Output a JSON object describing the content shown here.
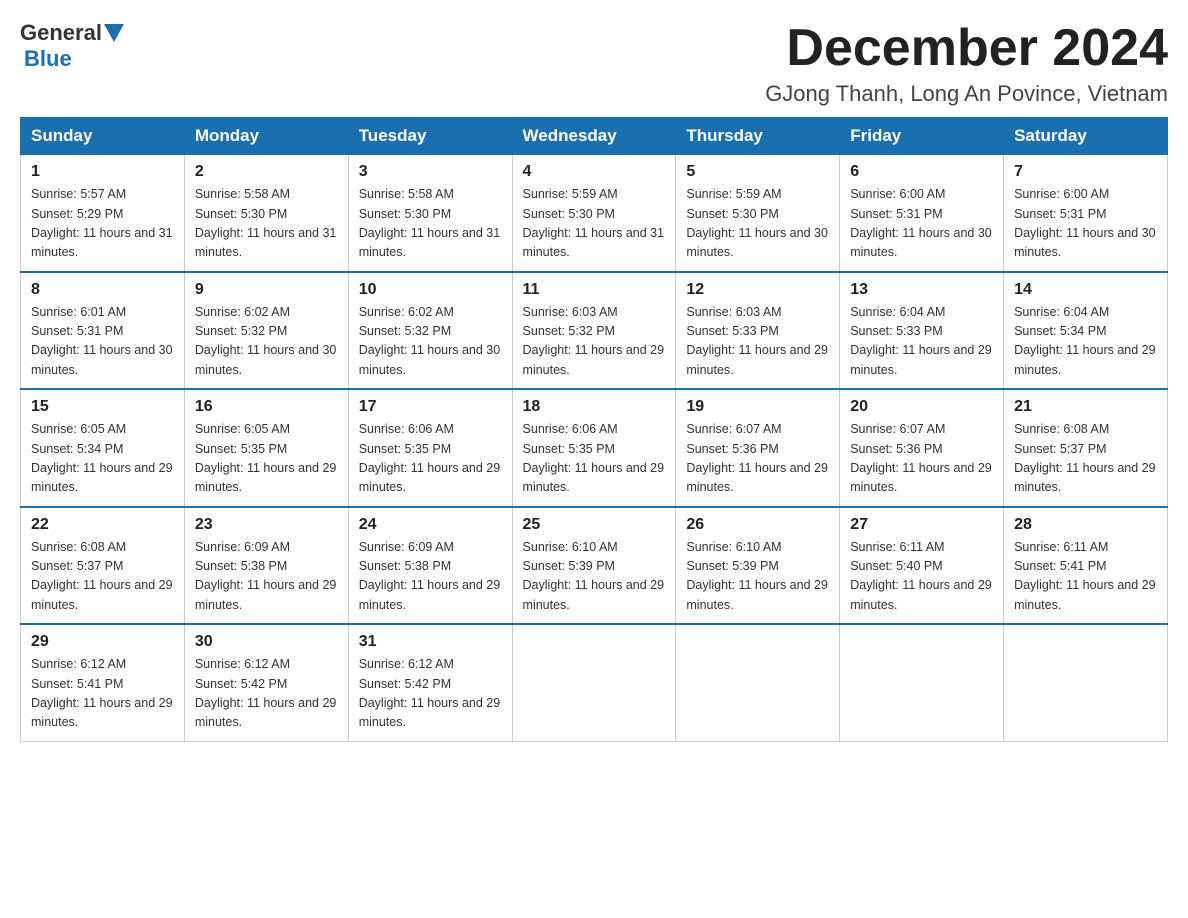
{
  "header": {
    "logo": {
      "general": "General",
      "blue": "Blue"
    },
    "title": "December 2024",
    "location": "GJong Thanh, Long An Povince, Vietnam"
  },
  "weekdays": [
    "Sunday",
    "Monday",
    "Tuesday",
    "Wednesday",
    "Thursday",
    "Friday",
    "Saturday"
  ],
  "weeks": [
    [
      {
        "day": "1",
        "sunrise": "5:57 AM",
        "sunset": "5:29 PM",
        "daylight": "11 hours and 31 minutes."
      },
      {
        "day": "2",
        "sunrise": "5:58 AM",
        "sunset": "5:30 PM",
        "daylight": "11 hours and 31 minutes."
      },
      {
        "day": "3",
        "sunrise": "5:58 AM",
        "sunset": "5:30 PM",
        "daylight": "11 hours and 31 minutes."
      },
      {
        "day": "4",
        "sunrise": "5:59 AM",
        "sunset": "5:30 PM",
        "daylight": "11 hours and 31 minutes."
      },
      {
        "day": "5",
        "sunrise": "5:59 AM",
        "sunset": "5:30 PM",
        "daylight": "11 hours and 30 minutes."
      },
      {
        "day": "6",
        "sunrise": "6:00 AM",
        "sunset": "5:31 PM",
        "daylight": "11 hours and 30 minutes."
      },
      {
        "day": "7",
        "sunrise": "6:00 AM",
        "sunset": "5:31 PM",
        "daylight": "11 hours and 30 minutes."
      }
    ],
    [
      {
        "day": "8",
        "sunrise": "6:01 AM",
        "sunset": "5:31 PM",
        "daylight": "11 hours and 30 minutes."
      },
      {
        "day": "9",
        "sunrise": "6:02 AM",
        "sunset": "5:32 PM",
        "daylight": "11 hours and 30 minutes."
      },
      {
        "day": "10",
        "sunrise": "6:02 AM",
        "sunset": "5:32 PM",
        "daylight": "11 hours and 30 minutes."
      },
      {
        "day": "11",
        "sunrise": "6:03 AM",
        "sunset": "5:32 PM",
        "daylight": "11 hours and 29 minutes."
      },
      {
        "day": "12",
        "sunrise": "6:03 AM",
        "sunset": "5:33 PM",
        "daylight": "11 hours and 29 minutes."
      },
      {
        "day": "13",
        "sunrise": "6:04 AM",
        "sunset": "5:33 PM",
        "daylight": "11 hours and 29 minutes."
      },
      {
        "day": "14",
        "sunrise": "6:04 AM",
        "sunset": "5:34 PM",
        "daylight": "11 hours and 29 minutes."
      }
    ],
    [
      {
        "day": "15",
        "sunrise": "6:05 AM",
        "sunset": "5:34 PM",
        "daylight": "11 hours and 29 minutes."
      },
      {
        "day": "16",
        "sunrise": "6:05 AM",
        "sunset": "5:35 PM",
        "daylight": "11 hours and 29 minutes."
      },
      {
        "day": "17",
        "sunrise": "6:06 AM",
        "sunset": "5:35 PM",
        "daylight": "11 hours and 29 minutes."
      },
      {
        "day": "18",
        "sunrise": "6:06 AM",
        "sunset": "5:35 PM",
        "daylight": "11 hours and 29 minutes."
      },
      {
        "day": "19",
        "sunrise": "6:07 AM",
        "sunset": "5:36 PM",
        "daylight": "11 hours and 29 minutes."
      },
      {
        "day": "20",
        "sunrise": "6:07 AM",
        "sunset": "5:36 PM",
        "daylight": "11 hours and 29 minutes."
      },
      {
        "day": "21",
        "sunrise": "6:08 AM",
        "sunset": "5:37 PM",
        "daylight": "11 hours and 29 minutes."
      }
    ],
    [
      {
        "day": "22",
        "sunrise": "6:08 AM",
        "sunset": "5:37 PM",
        "daylight": "11 hours and 29 minutes."
      },
      {
        "day": "23",
        "sunrise": "6:09 AM",
        "sunset": "5:38 PM",
        "daylight": "11 hours and 29 minutes."
      },
      {
        "day": "24",
        "sunrise": "6:09 AM",
        "sunset": "5:38 PM",
        "daylight": "11 hours and 29 minutes."
      },
      {
        "day": "25",
        "sunrise": "6:10 AM",
        "sunset": "5:39 PM",
        "daylight": "11 hours and 29 minutes."
      },
      {
        "day": "26",
        "sunrise": "6:10 AM",
        "sunset": "5:39 PM",
        "daylight": "11 hours and 29 minutes."
      },
      {
        "day": "27",
        "sunrise": "6:11 AM",
        "sunset": "5:40 PM",
        "daylight": "11 hours and 29 minutes."
      },
      {
        "day": "28",
        "sunrise": "6:11 AM",
        "sunset": "5:41 PM",
        "daylight": "11 hours and 29 minutes."
      }
    ],
    [
      {
        "day": "29",
        "sunrise": "6:12 AM",
        "sunset": "5:41 PM",
        "daylight": "11 hours and 29 minutes."
      },
      {
        "day": "30",
        "sunrise": "6:12 AM",
        "sunset": "5:42 PM",
        "daylight": "11 hours and 29 minutes."
      },
      {
        "day": "31",
        "sunrise": "6:12 AM",
        "sunset": "5:42 PM",
        "daylight": "11 hours and 29 minutes."
      },
      null,
      null,
      null,
      null
    ]
  ]
}
